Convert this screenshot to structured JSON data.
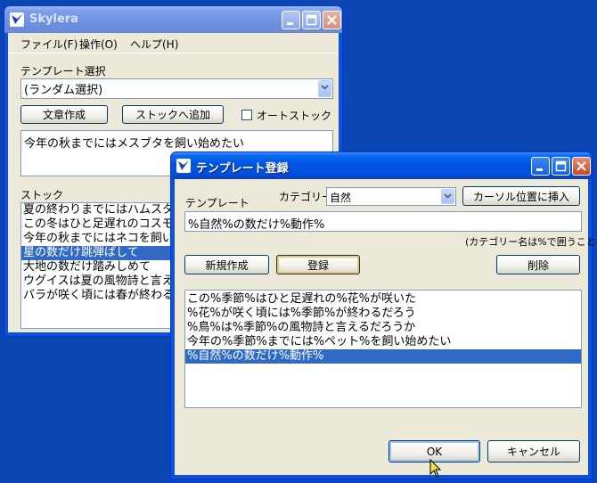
{
  "main_window": {
    "title": "Skylera",
    "menu": [
      "ファイル(F)",
      "操作(O)",
      "ヘルプ(H)"
    ],
    "template_select_label": "テンプレート選択",
    "template_select_value": "(ランダム選択)",
    "generate_button": "文章作成",
    "add_stock_button": "ストックへ追加",
    "auto_stock_label": "オートストック",
    "auto_stock_checked": false,
    "output_text": "今年の秋までにはメスブタを飼い始めたい",
    "stock_label": "ストック",
    "stock_items": [
      "夏の終わりまでにはハムスターを",
      "この冬はひと足遅れのコスモスが",
      "今年の秋までにはネコを飼い始め",
      "星の数だけ跳弾ばして",
      "大地の数だけ踏みしめて",
      "ウグイスは夏の風物詩と言える",
      "バラが咲く頃には春が終わる"
    ],
    "stock_selected_index": 3
  },
  "dialog": {
    "title": "テンプレート登録",
    "template_label": "テンプレート",
    "category_label": "カテゴリー",
    "category_value": "自然",
    "insert_cursor_button": "カーソル位置に挿入",
    "template_input_value": "%自然%の数だけ%動作%",
    "hint_text": "(カテゴリー名は%で囲うこと)",
    "new_button": "新規作成",
    "register_button": "登録",
    "delete_button": "削除",
    "templates": [
      "この%季節%はひと足遅れの%花%が咲いた",
      "%花%が咲く頃には%季節%が終わるだろう",
      "%鳥%は%季節%の風物詩と言えるだろうか",
      "今年の%季節%までには%ペット%を飼い始めたい",
      "%自然%の数だけ%動作%"
    ],
    "selected_index": 4,
    "ok_button": "OK",
    "cancel_button": "キャンセル"
  },
  "colors": {
    "desktop": "#0a47b5",
    "selection": "#316ac5",
    "window_face": "#ece9d8"
  }
}
